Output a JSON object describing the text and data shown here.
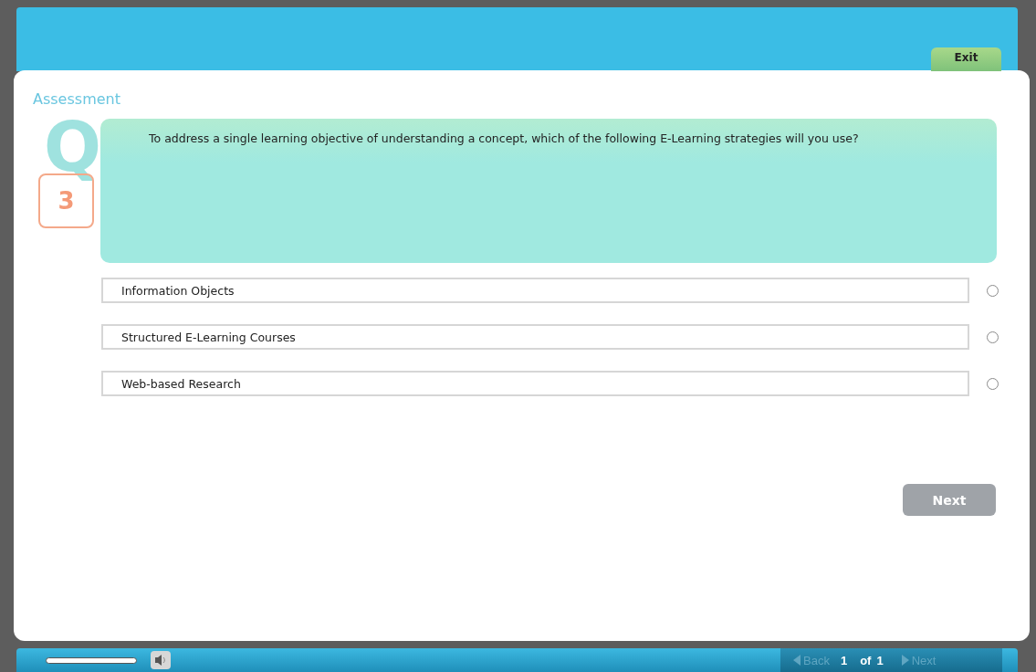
{
  "header": {
    "exit_button": "Exit"
  },
  "section_title": "Assessment",
  "question": {
    "letter": "Q",
    "number": "3",
    "text": "To address a single learning objective of understanding a concept, which of the following E-Learning strategies will you use?"
  },
  "options": [
    {
      "label": "Information Objects",
      "selected": false
    },
    {
      "label": "Structured E-Learning Courses",
      "selected": false
    },
    {
      "label": "Web-based Research",
      "selected": false
    }
  ],
  "next_button": {
    "label": "Next",
    "disabled": true
  },
  "footer": {
    "back": {
      "label": "Back",
      "disabled": true
    },
    "page": "1",
    "of": "of",
    "total": "1",
    "next": {
      "label": "Next",
      "disabled": true
    }
  }
}
